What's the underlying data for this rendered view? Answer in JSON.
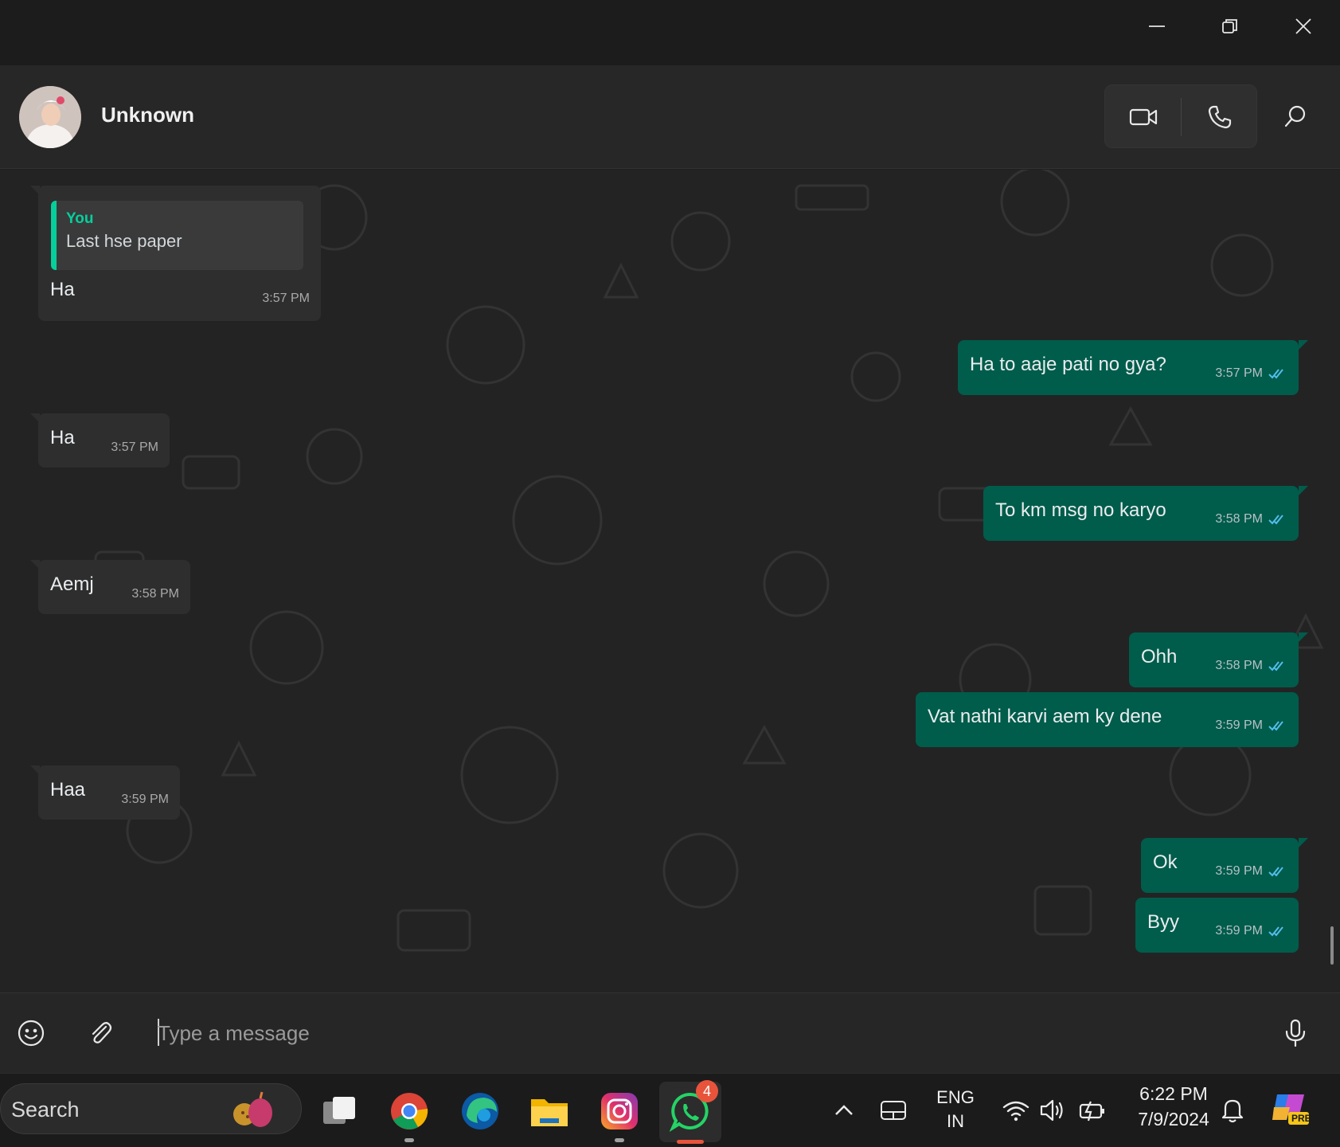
{
  "window": {
    "minimize_icon": "minimize-icon",
    "restore_icon": "restore-icon",
    "close_icon": "close-icon"
  },
  "header": {
    "contact_name": "Unknown",
    "video_icon": "video-camera-icon",
    "call_icon": "phone-icon",
    "search_icon": "search-icon"
  },
  "messages": [
    {
      "dir": "in",
      "quote_author": "You",
      "quote_text": "Last hse paper",
      "text": "Ha",
      "time": "3:57 PM"
    },
    {
      "dir": "out",
      "text": "Ha to aaje pati no gya?",
      "time": "3:57 PM",
      "status": "read"
    },
    {
      "dir": "in",
      "text": "Ha",
      "time": "3:57 PM"
    },
    {
      "dir": "out",
      "text": "To km msg no karyo",
      "time": "3:58 PM",
      "status": "read"
    },
    {
      "dir": "in",
      "text": "Aemj",
      "time": "3:58 PM"
    },
    {
      "dir": "out",
      "text": "Ohh",
      "time": "3:58 PM",
      "status": "read"
    },
    {
      "dir": "out",
      "text": "Vat nathi karvi aem ky dene",
      "time": "3:59 PM",
      "status": "read"
    },
    {
      "dir": "in",
      "text": "Haa",
      "time": "3:59 PM"
    },
    {
      "dir": "out",
      "text": "Ok",
      "time": "3:59 PM",
      "status": "read"
    },
    {
      "dir": "out",
      "text": "Byy",
      "time": "3:59 PM",
      "status": "read"
    }
  ],
  "composer": {
    "placeholder": "Type a message",
    "emoji_icon": "emoji-icon",
    "attach_icon": "paperclip-icon",
    "mic_icon": "microphone-icon"
  },
  "taskbar": {
    "search_label": "Search",
    "apps": [
      "task-view",
      "chrome",
      "edge",
      "file-explorer",
      "instagram",
      "whatsapp"
    ],
    "whatsapp_badge": "4",
    "language_line1": "ENG",
    "language_line2": "IN",
    "time": "6:22 PM",
    "date": "7/9/2024",
    "copilot_label": "PRE"
  },
  "colors": {
    "incoming": "#2e2e2e",
    "outgoing": "#005c4b",
    "accent": "#06cf9c",
    "read_ticks": "#53bdeb"
  }
}
